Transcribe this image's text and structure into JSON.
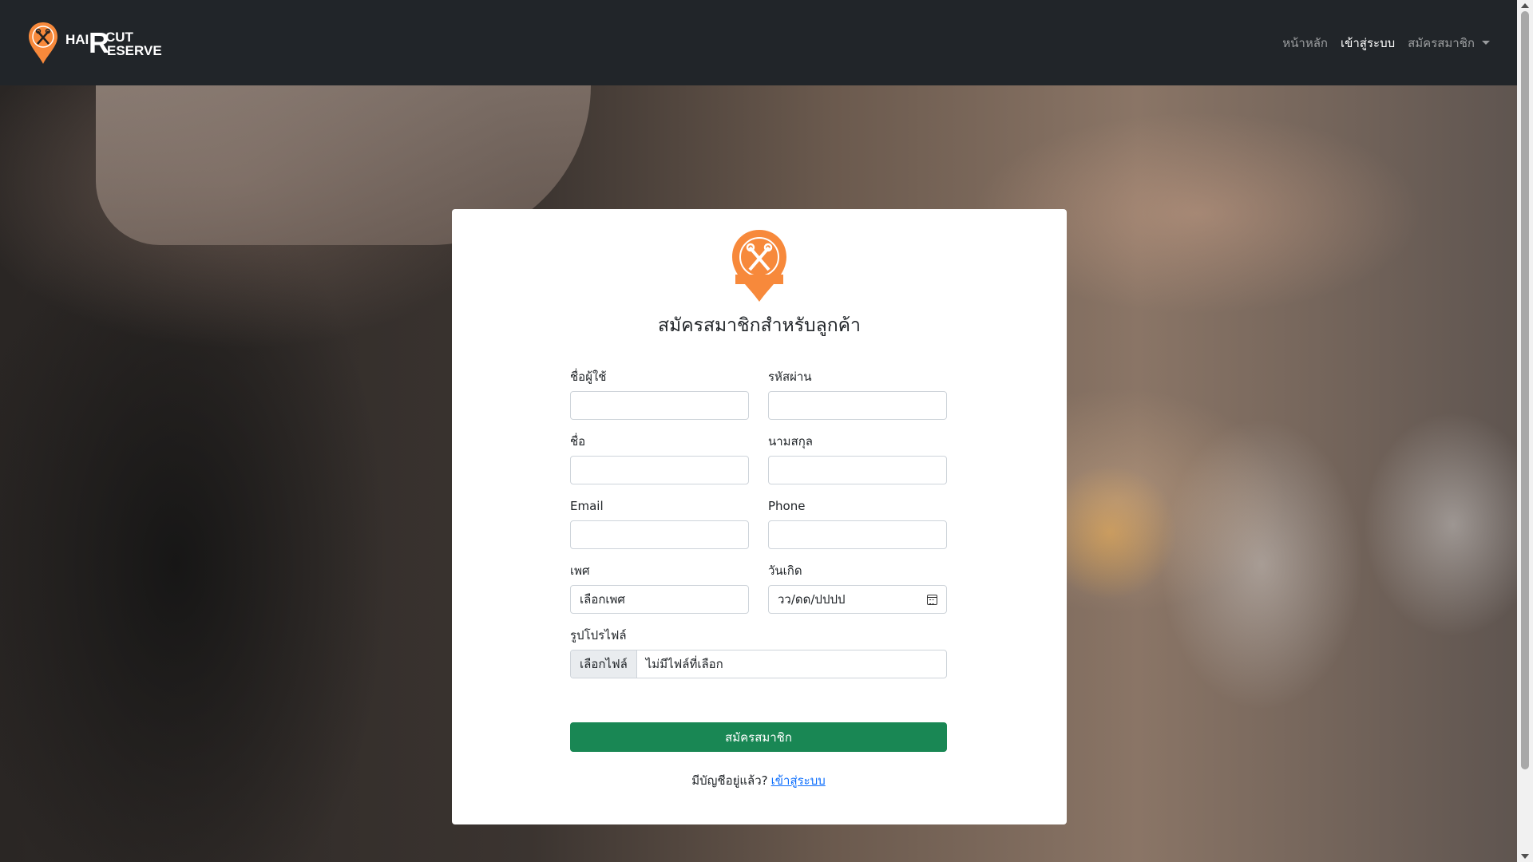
{
  "nav": {
    "brand": {
      "hai": "HAI",
      "r": "R",
      "cut": "CUT",
      "eserve": "ESERVE"
    },
    "links": [
      {
        "label": "หน้าหลัก"
      },
      {
        "label": "เข้าสู่ระบบ"
      },
      {
        "label": "สมัครสมาชิก"
      }
    ]
  },
  "form": {
    "title": "สมัครสมาชิกสำหรับลูกค้า",
    "username_label": "ชื่อผู้ใช้",
    "username_value": "",
    "password_label": "รหัสผ่าน",
    "password_value": "",
    "firstname_label": "ชื่อ",
    "firstname_value": "",
    "lastname_label": "นามสกุล",
    "lastname_value": "",
    "email_label": "Email",
    "email_value": "",
    "phone_label": "Phone",
    "phone_value": "",
    "gender_label": "เพศ",
    "gender_value": "เลือกเพศ",
    "birthdate_label": "วันเกิด",
    "birthdate_placeholder": "วว/ดด/ปปปป",
    "profile_label": "รูปโปรไฟล์",
    "file_button": "เลือกไฟล์",
    "file_status": "ไม่มีไฟล์ที่เลือก",
    "submit_label": "สมัครสมาชิก",
    "have_account_text": "มีบัญชีอยู่แล้ว?",
    "login_link": "เข้าสู่ระบบ"
  },
  "colors": {
    "navbar_bg": "#212529",
    "brand_orange": "#f7893b",
    "submit_green": "#198754",
    "link_blue": "#0d6efd"
  }
}
